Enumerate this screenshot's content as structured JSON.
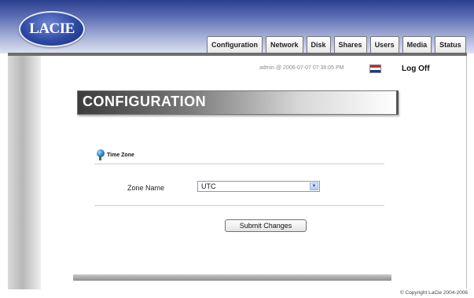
{
  "header": {
    "logo_text": "LACIE",
    "tabs": [
      "Configuration",
      "Network",
      "Disk",
      "Shares",
      "Users",
      "Media",
      "Status"
    ]
  },
  "userbar": {
    "user_info": "admin @ 2006-07-07 07:38:05 PM",
    "flag_icon": "us-flag-icon",
    "logoff_label": "Log Off"
  },
  "main": {
    "banner_title": "CONFIGURATION",
    "section_title": "Time Zone",
    "section_icon": "pushpin-icon",
    "zone_label": "Zone Name",
    "zone_value": "UTC",
    "submit_label": "Submit Changes"
  },
  "footer": {
    "copyright": "© Copyright LaCie 2004-2006"
  }
}
